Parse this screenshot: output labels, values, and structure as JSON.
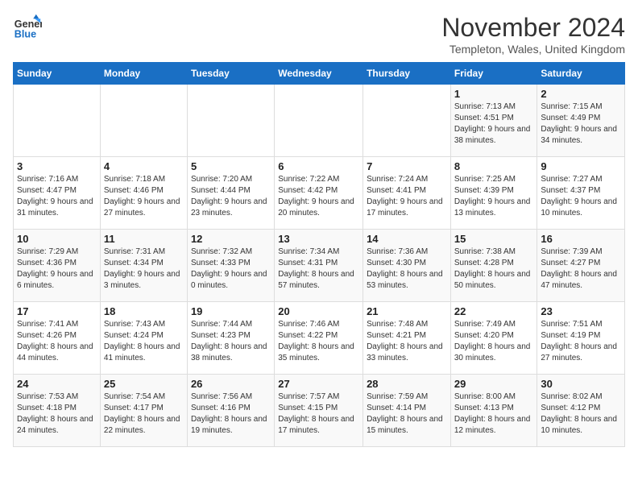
{
  "header": {
    "logo_line1": "General",
    "logo_line2": "Blue",
    "month": "November 2024",
    "location": "Templeton, Wales, United Kingdom"
  },
  "weekdays": [
    "Sunday",
    "Monday",
    "Tuesday",
    "Wednesday",
    "Thursday",
    "Friday",
    "Saturday"
  ],
  "weeks": [
    [
      {
        "day": "",
        "info": ""
      },
      {
        "day": "",
        "info": ""
      },
      {
        "day": "",
        "info": ""
      },
      {
        "day": "",
        "info": ""
      },
      {
        "day": "",
        "info": ""
      },
      {
        "day": "1",
        "info": "Sunrise: 7:13 AM\nSunset: 4:51 PM\nDaylight: 9 hours\nand 38 minutes."
      },
      {
        "day": "2",
        "info": "Sunrise: 7:15 AM\nSunset: 4:49 PM\nDaylight: 9 hours\nand 34 minutes."
      }
    ],
    [
      {
        "day": "3",
        "info": "Sunrise: 7:16 AM\nSunset: 4:47 PM\nDaylight: 9 hours\nand 31 minutes."
      },
      {
        "day": "4",
        "info": "Sunrise: 7:18 AM\nSunset: 4:46 PM\nDaylight: 9 hours\nand 27 minutes."
      },
      {
        "day": "5",
        "info": "Sunrise: 7:20 AM\nSunset: 4:44 PM\nDaylight: 9 hours\nand 23 minutes."
      },
      {
        "day": "6",
        "info": "Sunrise: 7:22 AM\nSunset: 4:42 PM\nDaylight: 9 hours\nand 20 minutes."
      },
      {
        "day": "7",
        "info": "Sunrise: 7:24 AM\nSunset: 4:41 PM\nDaylight: 9 hours\nand 17 minutes."
      },
      {
        "day": "8",
        "info": "Sunrise: 7:25 AM\nSunset: 4:39 PM\nDaylight: 9 hours\nand 13 minutes."
      },
      {
        "day": "9",
        "info": "Sunrise: 7:27 AM\nSunset: 4:37 PM\nDaylight: 9 hours\nand 10 minutes."
      }
    ],
    [
      {
        "day": "10",
        "info": "Sunrise: 7:29 AM\nSunset: 4:36 PM\nDaylight: 9 hours\nand 6 minutes."
      },
      {
        "day": "11",
        "info": "Sunrise: 7:31 AM\nSunset: 4:34 PM\nDaylight: 9 hours\nand 3 minutes."
      },
      {
        "day": "12",
        "info": "Sunrise: 7:32 AM\nSunset: 4:33 PM\nDaylight: 9 hours\nand 0 minutes."
      },
      {
        "day": "13",
        "info": "Sunrise: 7:34 AM\nSunset: 4:31 PM\nDaylight: 8 hours\nand 57 minutes."
      },
      {
        "day": "14",
        "info": "Sunrise: 7:36 AM\nSunset: 4:30 PM\nDaylight: 8 hours\nand 53 minutes."
      },
      {
        "day": "15",
        "info": "Sunrise: 7:38 AM\nSunset: 4:28 PM\nDaylight: 8 hours\nand 50 minutes."
      },
      {
        "day": "16",
        "info": "Sunrise: 7:39 AM\nSunset: 4:27 PM\nDaylight: 8 hours\nand 47 minutes."
      }
    ],
    [
      {
        "day": "17",
        "info": "Sunrise: 7:41 AM\nSunset: 4:26 PM\nDaylight: 8 hours\nand 44 minutes."
      },
      {
        "day": "18",
        "info": "Sunrise: 7:43 AM\nSunset: 4:24 PM\nDaylight: 8 hours\nand 41 minutes."
      },
      {
        "day": "19",
        "info": "Sunrise: 7:44 AM\nSunset: 4:23 PM\nDaylight: 8 hours\nand 38 minutes."
      },
      {
        "day": "20",
        "info": "Sunrise: 7:46 AM\nSunset: 4:22 PM\nDaylight: 8 hours\nand 35 minutes."
      },
      {
        "day": "21",
        "info": "Sunrise: 7:48 AM\nSunset: 4:21 PM\nDaylight: 8 hours\nand 33 minutes."
      },
      {
        "day": "22",
        "info": "Sunrise: 7:49 AM\nSunset: 4:20 PM\nDaylight: 8 hours\nand 30 minutes."
      },
      {
        "day": "23",
        "info": "Sunrise: 7:51 AM\nSunset: 4:19 PM\nDaylight: 8 hours\nand 27 minutes."
      }
    ],
    [
      {
        "day": "24",
        "info": "Sunrise: 7:53 AM\nSunset: 4:18 PM\nDaylight: 8 hours\nand 24 minutes."
      },
      {
        "day": "25",
        "info": "Sunrise: 7:54 AM\nSunset: 4:17 PM\nDaylight: 8 hours\nand 22 minutes."
      },
      {
        "day": "26",
        "info": "Sunrise: 7:56 AM\nSunset: 4:16 PM\nDaylight: 8 hours\nand 19 minutes."
      },
      {
        "day": "27",
        "info": "Sunrise: 7:57 AM\nSunset: 4:15 PM\nDaylight: 8 hours\nand 17 minutes."
      },
      {
        "day": "28",
        "info": "Sunrise: 7:59 AM\nSunset: 4:14 PM\nDaylight: 8 hours\nand 15 minutes."
      },
      {
        "day": "29",
        "info": "Sunrise: 8:00 AM\nSunset: 4:13 PM\nDaylight: 8 hours\nand 12 minutes."
      },
      {
        "day": "30",
        "info": "Sunrise: 8:02 AM\nSunset: 4:12 PM\nDaylight: 8 hours\nand 10 minutes."
      }
    ]
  ]
}
